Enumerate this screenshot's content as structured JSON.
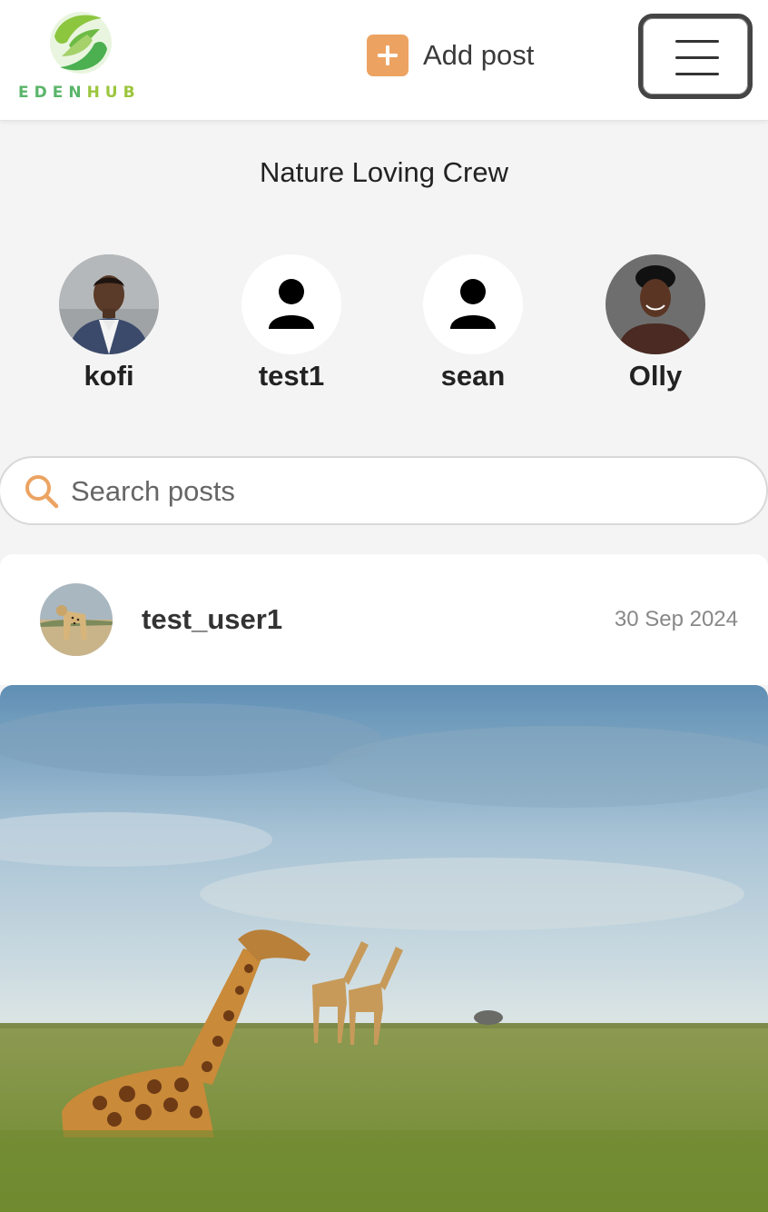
{
  "header": {
    "logo": {
      "part1": "EDEN",
      "part2": "HUB",
      "colors": {
        "eden": "#5ab56a",
        "hub": "#9cc63d"
      }
    },
    "add_post_label": "Add post",
    "add_post_icon": "plus-square-icon",
    "menu_icon": "hamburger-icon"
  },
  "group": {
    "title": "Nature Loving Crew",
    "members": [
      {
        "name": "kofi",
        "avatar": "photo"
      },
      {
        "name": "test1",
        "avatar": "default-person-icon"
      },
      {
        "name": "sean",
        "avatar": "default-person-icon"
      },
      {
        "name": "Olly",
        "avatar": "photo"
      }
    ]
  },
  "search": {
    "placeholder": "Search posts",
    "value": "",
    "icon": "search-icon"
  },
  "post": {
    "user": "test_user1",
    "date": "30 Sep 2024",
    "image": "giraffes-savanna-photo"
  },
  "colors": {
    "accent": "#eca362",
    "background": "#f4f4f4"
  }
}
